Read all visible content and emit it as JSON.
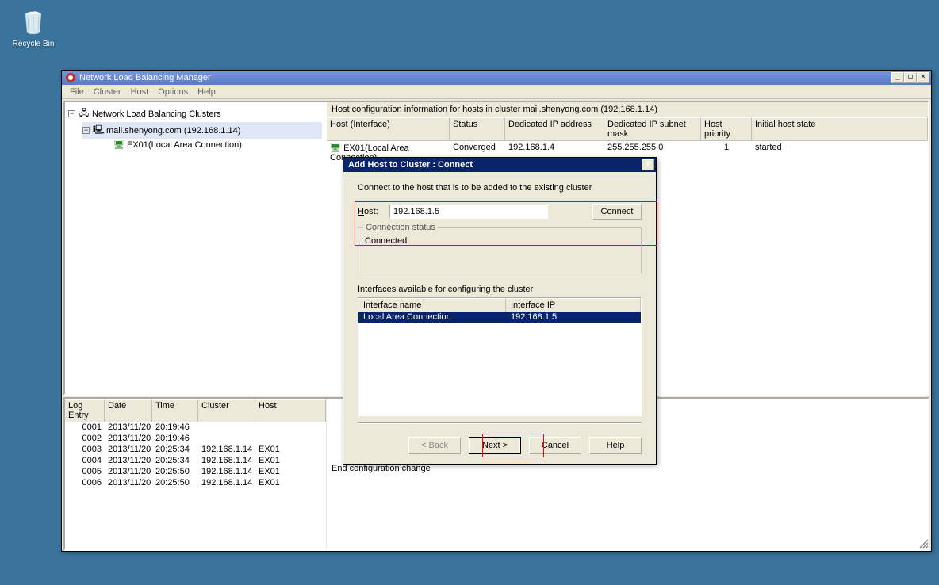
{
  "desktop": {
    "recycle_bin": "Recycle Bin"
  },
  "window": {
    "title": "Network Load Balancing Manager",
    "menus": [
      "File",
      "Cluster",
      "Host",
      "Options",
      "Help"
    ]
  },
  "tree": {
    "root": "Network Load Balancing Clusters",
    "cluster": "mail.shenyong.com (192.168.1.14)",
    "host": "EX01(Local Area Connection)"
  },
  "right_header": "Host configuration information for hosts in cluster mail.shenyong.com (192.168.1.14)",
  "host_table": {
    "headers": [
      "Host (Interface)",
      "Status",
      "Dedicated IP address",
      "Dedicated IP subnet mask",
      "Host priority",
      "Initial host state"
    ],
    "row": {
      "host": "EX01(Local Area Connection)",
      "status": "Converged",
      "ip": "192.168.1.4",
      "mask": "255.255.255.0",
      "priority": "1",
      "state": "started"
    }
  },
  "log": {
    "headers": [
      "Log Entry",
      "Date",
      "Time",
      "Cluster",
      "Host"
    ],
    "rows": [
      {
        "entry": "0001",
        "date": "2013/11/20",
        "time": "20:19:46",
        "cluster": "",
        "host": ""
      },
      {
        "entry": "0002",
        "date": "2013/11/20",
        "time": "20:19:46",
        "cluster": "",
        "host": ""
      },
      {
        "entry": "0003",
        "date": "2013/11/20",
        "time": "20:25:34",
        "cluster": "192.168.1.14",
        "host": "EX01"
      },
      {
        "entry": "0004",
        "date": "2013/11/20",
        "time": "20:25:34",
        "cluster": "192.168.1.14",
        "host": "EX01"
      },
      {
        "entry": "0005",
        "date": "2013/11/20",
        "time": "20:25:50",
        "cluster": "192.168.1.14",
        "host": "EX01"
      },
      {
        "entry": "0006",
        "date": "2013/11/20",
        "time": "20:25:50",
        "cluster": "192.168.1.14",
        "host": "EX01"
      }
    ],
    "right_text": "End configuration change"
  },
  "dialog": {
    "title": "Add Host to Cluster :  Connect",
    "instruction": "Connect to the host that is to be added to the existing cluster",
    "host_label": "Host:",
    "host_value": "192.168.1.5",
    "connect_btn": "Connect",
    "status_legend": "Connection status",
    "status_text": "Connected",
    "interfaces_label": "Interfaces available for configuring the cluster",
    "interface_headers": [
      "Interface name",
      "Interface IP"
    ],
    "interface_row": {
      "name": "Local Area Connection",
      "ip": "192.168.1.5"
    },
    "buttons": {
      "back": "< Back",
      "next": "Next >",
      "cancel": "Cancel",
      "help": "Help"
    }
  }
}
